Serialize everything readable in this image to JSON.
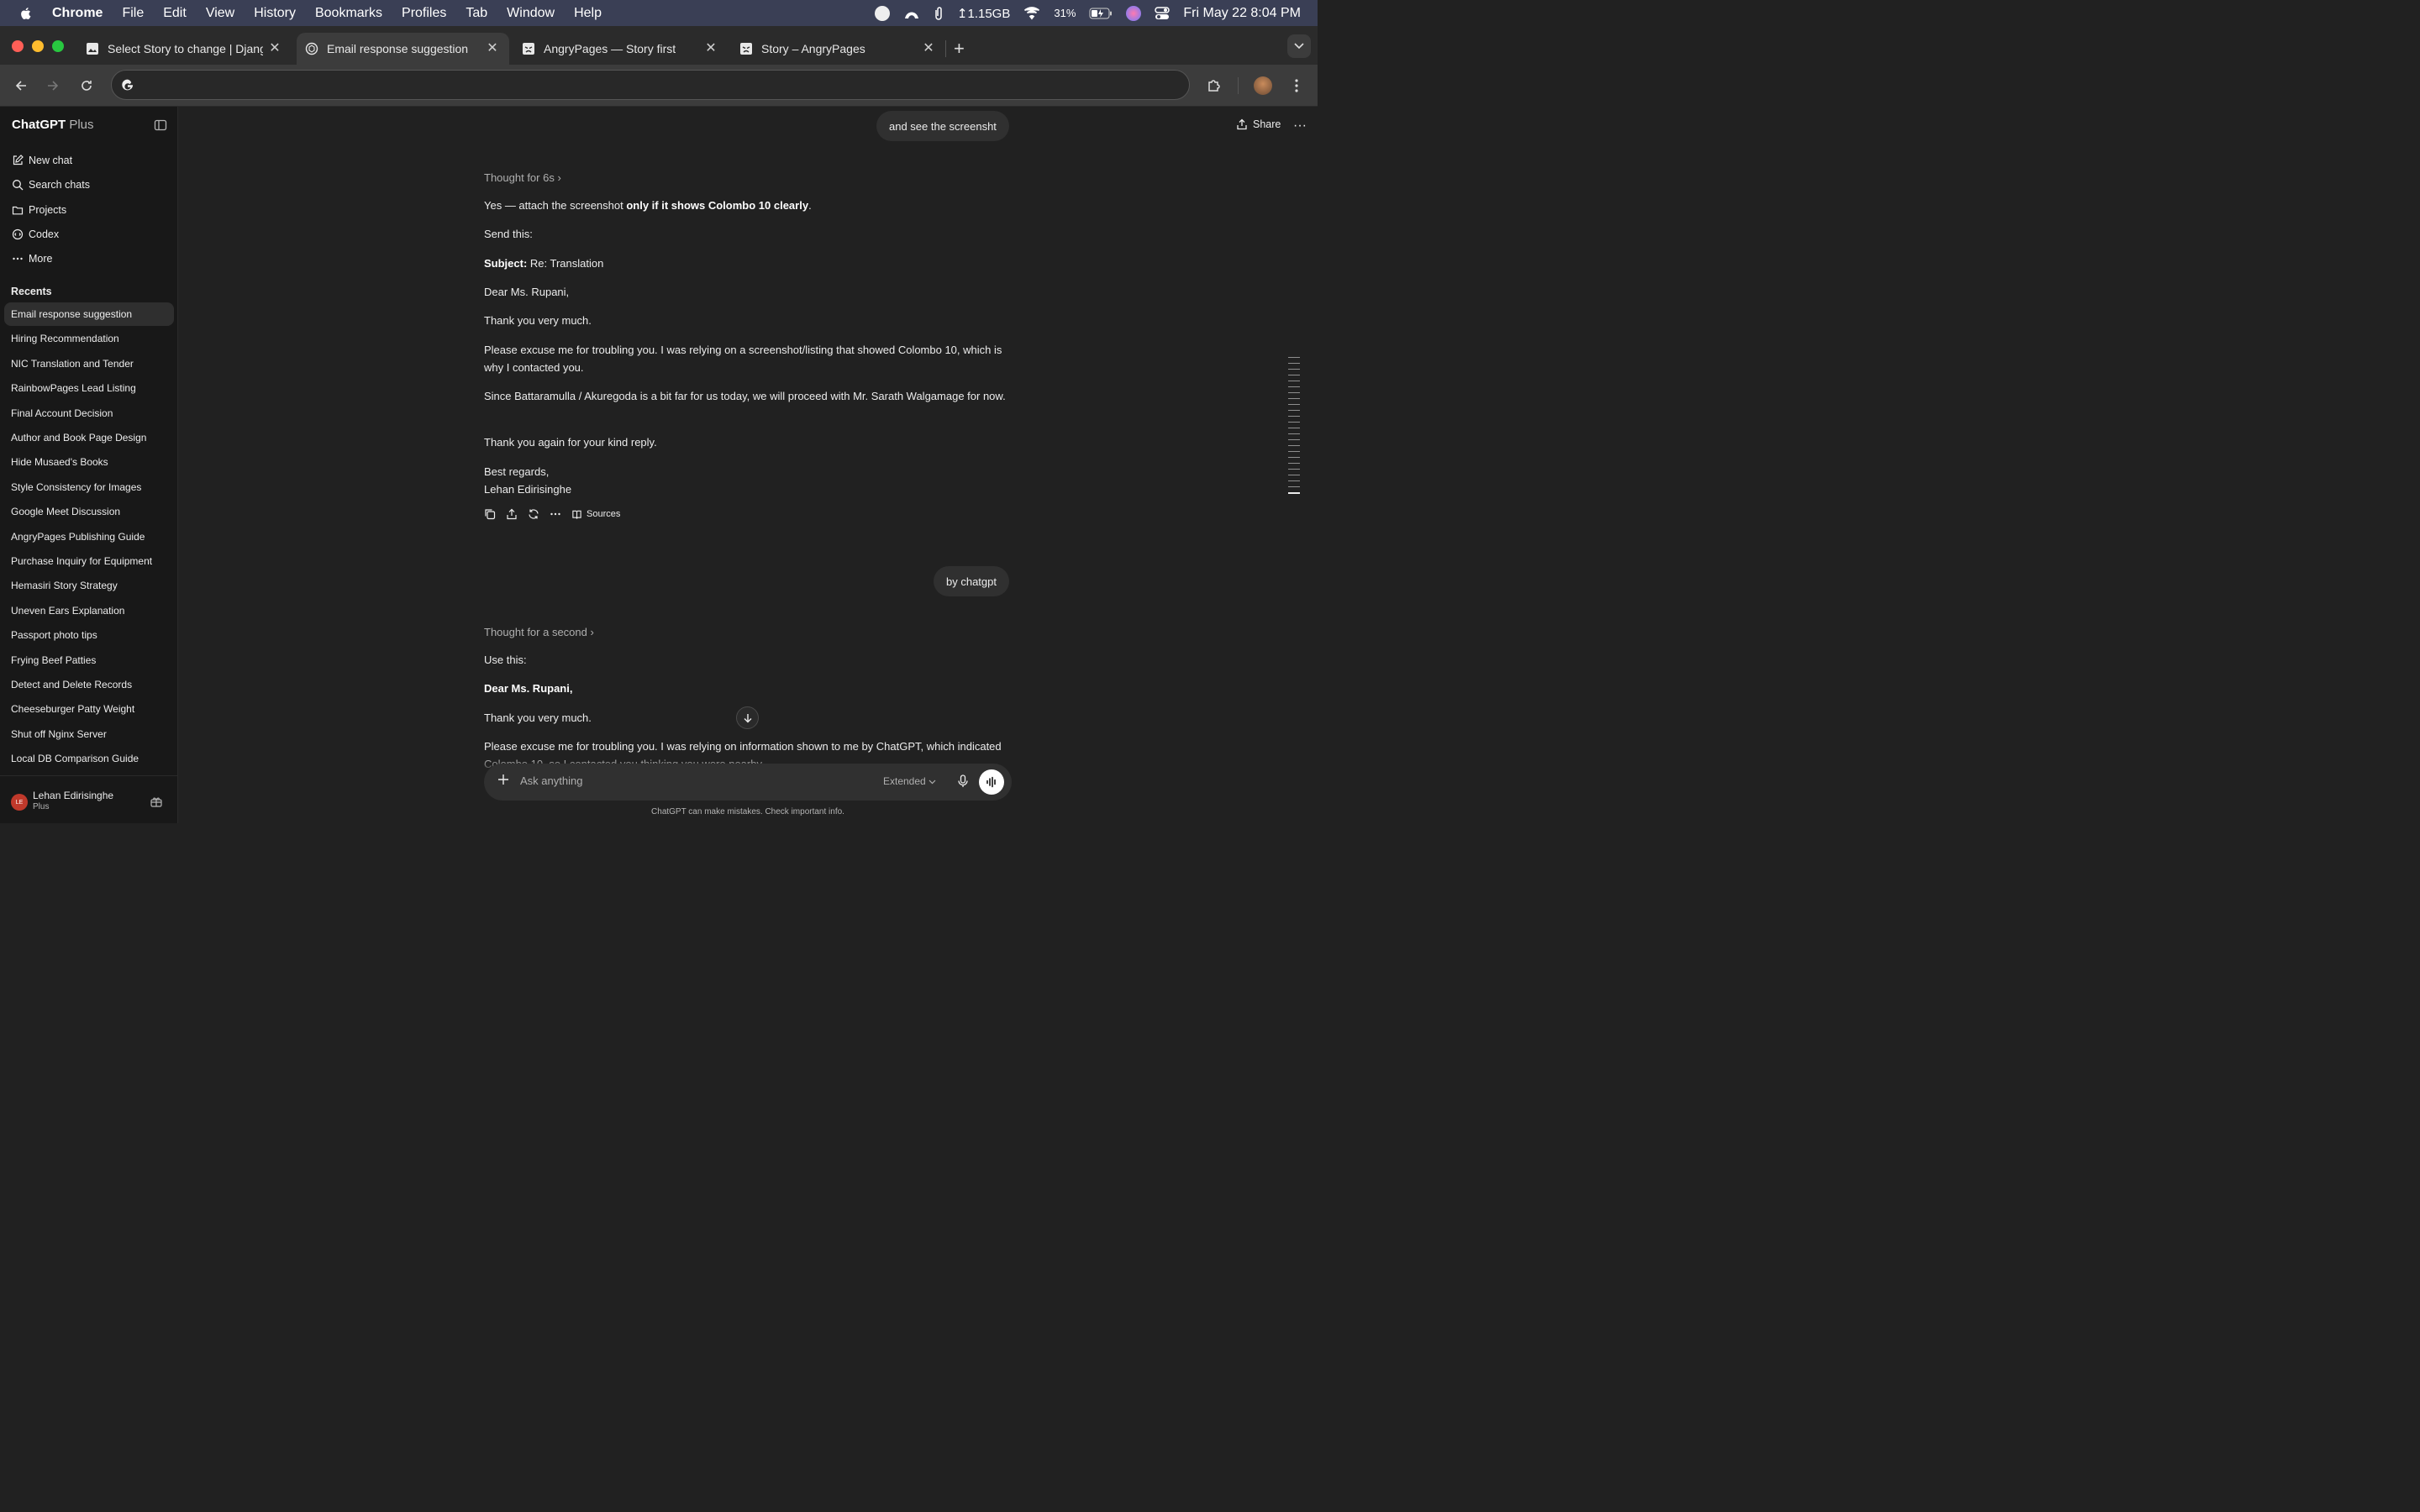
{
  "menubar": {
    "app": "Chrome",
    "items": [
      "File",
      "Edit",
      "View",
      "History",
      "Bookmarks",
      "Profiles",
      "Tab",
      "Window",
      "Help"
    ],
    "memory": "↥1.15GB",
    "battery": "31%",
    "clock": "Fri May 22  8:04 PM"
  },
  "tabs": [
    {
      "title": "Select Story to change | Djang",
      "icon": "django-page-icon"
    },
    {
      "title": "Email response suggestion",
      "icon": "chatgpt-icon",
      "active": true
    },
    {
      "title": "AngryPages — Story first",
      "icon": "angrypages-icon"
    },
    {
      "title": "Story – AngryPages",
      "icon": "angrypages-icon"
    }
  ],
  "omnibox": {
    "value": ""
  },
  "sidebar": {
    "brand": "ChatGPT",
    "plan": "Plus",
    "nav": [
      {
        "label": "New chat",
        "icon": "compose-icon"
      },
      {
        "label": "Search chats",
        "icon": "search-icon"
      },
      {
        "label": "Projects",
        "icon": "folder-icon"
      },
      {
        "label": "Codex",
        "icon": "codex-icon"
      },
      {
        "label": "More",
        "icon": "ellipsis-icon"
      }
    ],
    "recents_label": "Recents",
    "recents": [
      "Email response suggestion",
      "Hiring Recommendation",
      "NIC Translation and Tender",
      "RainbowPages Lead Listing",
      "Final Account Decision",
      "Author and Book Page Design",
      "Hide Musaed's Books",
      "Style Consistency for Images",
      "Google Meet Discussion",
      "AngryPages Publishing Guide",
      "Purchase Inquiry for Equipment",
      "Hemasiri Story Strategy",
      "Uneven Ears Explanation",
      "Passport photo tips",
      "Frying Beef Patties",
      "Detect and Delete Records",
      "Cheeseburger Patty Weight",
      "Shut off Nginx Server",
      "Local DB Comparison Guide"
    ],
    "user": {
      "initials": "LE",
      "name": "Lehan Edirisinghe",
      "plan": "Plus"
    }
  },
  "header": {
    "share_label": "Share"
  },
  "conversation": {
    "user_msg_1": "and see the screensht",
    "thought_1": "Thought for 6s ›",
    "r1": {
      "intro_pre": "Yes — attach the screenshot ",
      "intro_bold": "only if it shows Colombo 10 clearly",
      "intro_post": ".",
      "send": "Send this:",
      "subject_label": "Subject:",
      "subject_value": " Re: Translation",
      "greeting": "Dear Ms. Rupani,",
      "thanks": "Thank you very much.",
      "para1": "Please excuse me for troubling you. I was relying on a screenshot/listing that showed Colombo 10, which is why I contacted you.",
      "para2": "Since Battaramulla / Akuregoda is a bit far for us today, we will proceed with Mr. Sarath Walgamage for now.",
      "thanks2": "Thank you again for your kind reply.",
      "signoff": "Best regards,",
      "name": "Lehan Edirisinghe"
    },
    "sources_label": "Sources",
    "user_msg_2": "by chatgpt",
    "thought_2": "Thought for a second ›",
    "r2": {
      "use": "Use this:",
      "greeting": "Dear Ms. Rupani,",
      "thanks": "Thank you very much.",
      "para1": "Please excuse me for troubling you. I was relying on information shown to me by ChatGPT, which indicated Colombo 10, so I contacted you thinking you were nearby."
    }
  },
  "composer": {
    "placeholder": "Ask anything",
    "mode": "Extended",
    "disclaimer": "ChatGPT can make mistakes. Check important info."
  }
}
